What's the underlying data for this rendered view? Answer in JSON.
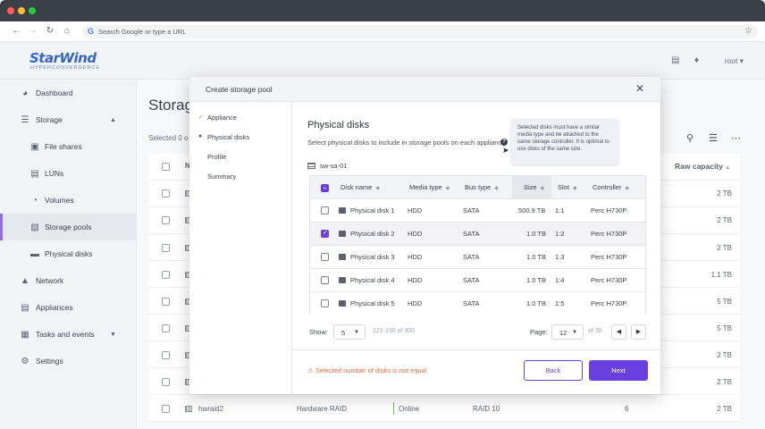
{
  "browser": {
    "omnibox_placeholder": "Search Google or type a URL",
    "google_glyph": "G"
  },
  "header": {
    "logo": "StarWind",
    "logo_sub": "HYPERCONVERGENCE",
    "user": "root"
  },
  "sidebar": {
    "items": [
      {
        "label": "Dashboard",
        "icon": "dashboard-icon"
      },
      {
        "label": "Storage",
        "icon": "storage-icon"
      },
      {
        "label": "File shares",
        "icon": "folder-icon"
      },
      {
        "label": "LUNs",
        "icon": "lun-icon"
      },
      {
        "label": "Volumes",
        "icon": "pie-icon"
      },
      {
        "label": "Storage pools",
        "icon": "pool-icon"
      },
      {
        "label": "Physical disks",
        "icon": "disk-icon"
      },
      {
        "label": "Network",
        "icon": "network-icon"
      },
      {
        "label": "Appliances",
        "icon": "appliance-icon"
      },
      {
        "label": "Tasks and events",
        "icon": "tasks-icon"
      },
      {
        "label": "Settings",
        "icon": "gear-icon"
      }
    ]
  },
  "main": {
    "title": "Storag",
    "selected_prefix": "Selected 0 o",
    "col_n": "N",
    "raw_capacity_header": "Raw capacity",
    "raw_capacity": [
      "2 TB",
      "2 TB",
      "2 TB",
      "1.1 TB",
      "5 TB",
      "5 TB",
      "2 TB",
      "2 TB",
      "2 TB"
    ],
    "last_row": {
      "name": "hwraid2",
      "type": "Hardware RAID",
      "status": "Online",
      "raid": "RAID 10",
      "disks": "6"
    }
  },
  "modal": {
    "title": "Create storage pool",
    "steps": [
      "Appliance",
      "Physical disks",
      "Profile",
      "Summary"
    ],
    "section_title": "Physical disks",
    "section_sub": "Select physical disks to include in storage pools on each appliance",
    "help_glyph": "?",
    "tooltip": "Selected disks must have a similar media type and be attached to the same storage controller. It is optimal to use disks of the same size.",
    "server": "sw-sa-01",
    "columns": [
      "Disk name",
      "Media type",
      "Bus type",
      "Size",
      "Slot",
      "Controller"
    ],
    "rows": [
      {
        "name": "Physical disk 1",
        "media": "HDD",
        "bus": "SATA",
        "size": "500.9 TB",
        "slot": "1:1",
        "controller": "Perc H730P",
        "checked": false
      },
      {
        "name": "Physical disk 2",
        "media": "HDD",
        "bus": "SATA",
        "size": "1.0 TB",
        "slot": "1:2",
        "controller": "Perc H730P",
        "checked": true
      },
      {
        "name": "Physical disk 3",
        "media": "HDD",
        "bus": "SATA",
        "size": "1.0 TB",
        "slot": "1:3",
        "controller": "Perc H730P",
        "checked": false
      },
      {
        "name": "Physical disk 4",
        "media": "HDD",
        "bus": "SATA",
        "size": "1.0 TB",
        "slot": "1:4",
        "controller": "Perc H730P",
        "checked": false
      },
      {
        "name": "Physical disk 5",
        "media": "HDD",
        "bus": "SATA",
        "size": "1.0 TB",
        "slot": "1:5",
        "controller": "Perc H730P",
        "checked": false
      }
    ],
    "pager": {
      "show_label": "Show:",
      "show_value": "5",
      "range": "121-130 of 300",
      "page_label": "Page:",
      "page_value": "12",
      "page_total": "of 30"
    },
    "warning": "Selected number of disks is not equal",
    "back_label": "Back",
    "next_label": "Next"
  },
  "colors": {
    "accent": "#6a3fe0",
    "warning": "#e0683a",
    "brand": "#3566c7"
  }
}
